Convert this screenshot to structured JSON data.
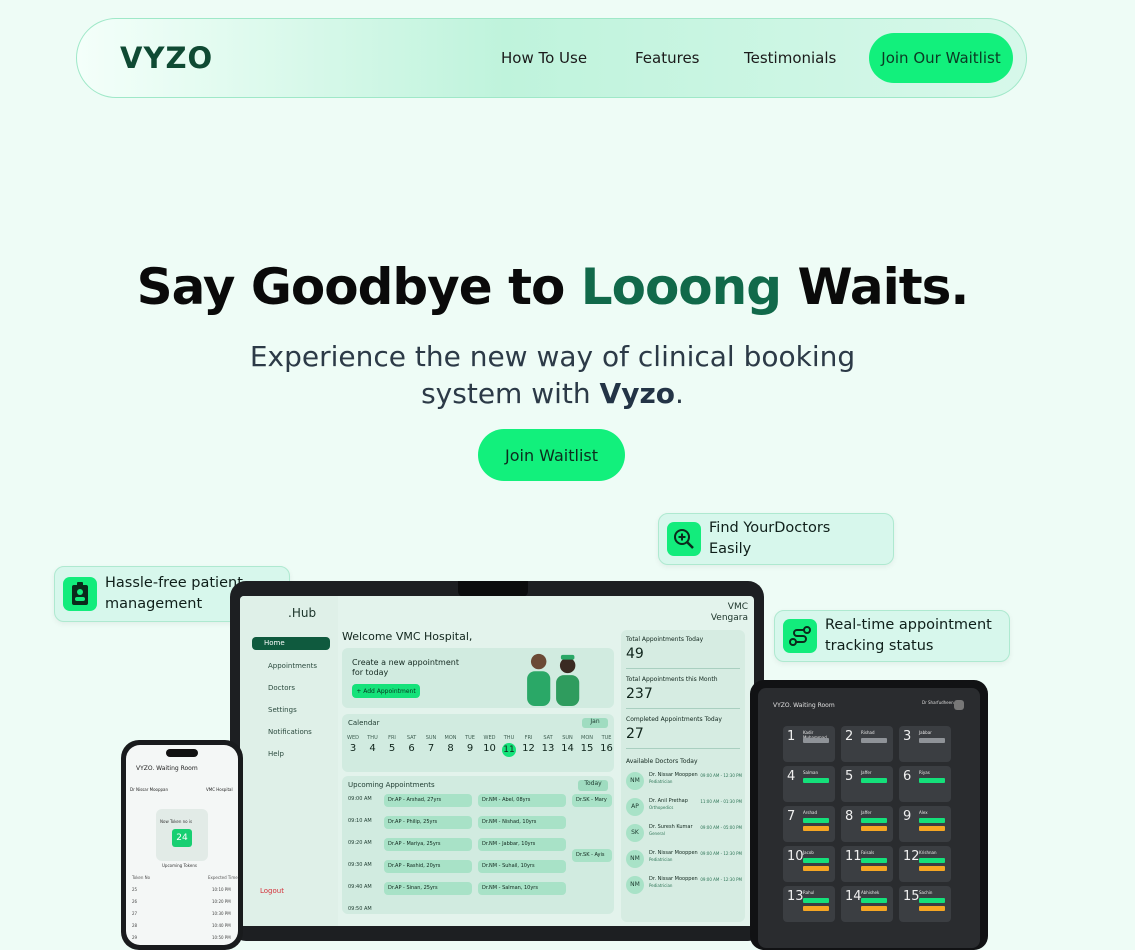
{
  "nav": {
    "logo": "VYZO",
    "links": [
      "How To Use",
      "Features",
      "Testimonials"
    ],
    "cta": "Join Our Waitlist"
  },
  "hero": {
    "title_pre": "Say Goodbye to ",
    "title_accent": "Looong",
    "title_post": " Waits.",
    "subtitle_pre": "Experience the new way of clinical booking system with ",
    "subtitle_brand": "Vyzo",
    "subtitle_post": ".",
    "button": "Join Waitlist"
  },
  "badges": {
    "find": {
      "line1": "Find YourDoctors",
      "line2": "Easily",
      "icon": "search-plus-icon"
    },
    "patient": {
      "line1": "Hassle-free patient",
      "line2": "management",
      "icon": "patient-id-icon"
    },
    "tracking": {
      "line1": "Real-time appointment",
      "line2": "tracking status",
      "icon": "route-icon"
    }
  },
  "dashboard": {
    "brand": ".Hub",
    "hospital": "VMC",
    "location": "Vengara",
    "sidebar": [
      "Home",
      "Appointments",
      "Doctors",
      "Settings",
      "Notifications",
      "Help"
    ],
    "logout": "Logout",
    "welcome": "Welcome VMC Hospital,",
    "create_line1": "Create a new appointment",
    "create_line2": "for today",
    "add_button": "+ Add Appointment",
    "calendar_title": "Calendar",
    "calendar_month": "Jan",
    "weekdays": [
      "WED",
      "THU",
      "FRI",
      "SAT",
      "SUN",
      "MON",
      "TUE",
      "WED",
      "THU",
      "FRI",
      "SAT",
      "SUN",
      "MON",
      "TUE"
    ],
    "days": [
      "3",
      "4",
      "5",
      "6",
      "7",
      "8",
      "9",
      "10",
      "11",
      "12",
      "13",
      "14",
      "15",
      "16"
    ],
    "selected_day": "11",
    "upcoming_title": "Upcoming Appointments",
    "upcoming_filter": "Today",
    "times": [
      "09:00 AM",
      "09:10 AM",
      "09:20 AM",
      "09:30 AM",
      "09:40 AM",
      "09:50 AM"
    ],
    "chips_col1": [
      "Dr.AP - Arshad, 27yrs",
      "Dr.AP - Philip, 25yrs",
      "Dr.AP - Mariya, 25yrs",
      "Dr.AP - Rashid, 20yrs",
      "Dr.AP - Sinan, 25yrs"
    ],
    "chips_col2": [
      "Dr.NM - Abel, 08yrs",
      "Dr.NM - Nishad, 10yrs",
      "Dr.NM - Jabbar, 10yrs",
      "Dr.NM - Suhail, 10yrs",
      "Dr.NM - Salman, 10yrs"
    ],
    "chips_col3": [
      "Dr.SK - Mary",
      "Dr.SK - Ayis"
    ],
    "stat1_label": "Total Appointments Today",
    "stat1_value": "49",
    "stat2_label": "Total Appointments this Month",
    "stat2_value": "237",
    "stat3_label": "Completed Appointments Today",
    "stat3_value": "27",
    "available_title": "Available Doctors Today",
    "doctors": [
      {
        "initials": "NM",
        "name": "Dr. Nissar Mooppen",
        "spec": "Pediatrician",
        "time": "09:00 AM - 12:30 PM"
      },
      {
        "initials": "AP",
        "name": "Dr. Anil Prethap",
        "spec": "Orthopedics",
        "time": "11:00 AM - 01:30 PM"
      },
      {
        "initials": "SK",
        "name": "Dr. Suresh Kumar",
        "spec": "General",
        "time": "09:00 AM - 05:00 PM"
      },
      {
        "initials": "NM",
        "name": "Dr. Nissar Mooppen",
        "spec": "Pediatrician",
        "time": "09:00 AM - 12:30 PM"
      },
      {
        "initials": "NM",
        "name": "Dr. Nissar Mooppen",
        "spec": "Pediatrician",
        "time": "09:00 AM - 12:30 PM"
      }
    ]
  },
  "phone": {
    "title": "VYZO. Waiting Room",
    "doctor": "Dr Nissar Mooppan",
    "hospital": "VMC Hospital",
    "now_label": "Now Token no is",
    "token": "24",
    "upcoming": "Upcoming Tokens",
    "col1": "Token No",
    "col2": "Expected Time",
    "rows": [
      [
        "25",
        "10:10 PM"
      ],
      [
        "26",
        "10:20 PM"
      ],
      [
        "27",
        "10:30 PM"
      ],
      [
        "28",
        "10:40 PM"
      ],
      [
        "29",
        "10:50 PM"
      ]
    ]
  },
  "tablet": {
    "title": "VYZO. Waiting Room",
    "doctor": "Dr Sharfudheen",
    "cells": [
      "1",
      "2",
      "3",
      "4",
      "5",
      "6",
      "7",
      "8",
      "9",
      "10",
      "11",
      "12",
      "13",
      "14",
      "15"
    ],
    "names": [
      "Kadir Muhammad",
      "Rishad",
      "Jabbar",
      "Salman",
      "Jaffer",
      "Riyas",
      "Arshad",
      "Jaffer",
      "Alex",
      "Jacob",
      "Faisals",
      "Krishnan",
      "Rahul",
      "Abhishek",
      "Sachin"
    ]
  }
}
